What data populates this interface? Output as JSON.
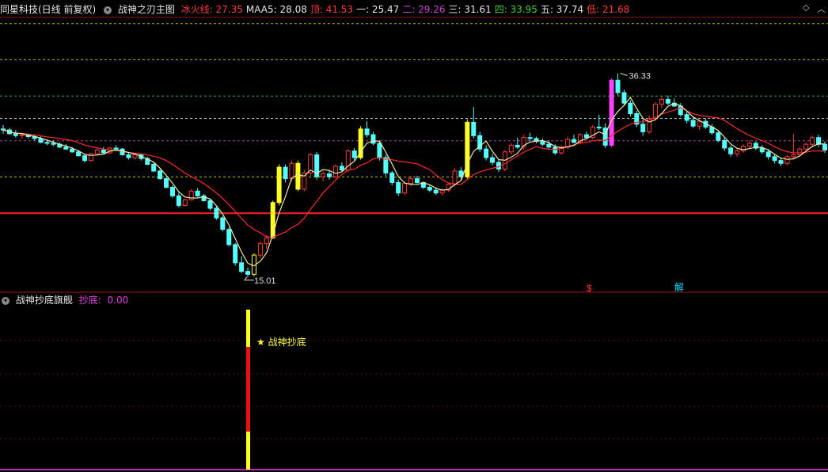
{
  "top_header": {
    "security": "同星科技(日线 前复权)",
    "indicator_name": "战神之刃主图",
    "items": [
      {
        "label": "冰火线: ",
        "value": "27.35",
        "color": "#ff3b3b"
      },
      {
        "label": "MAA5: ",
        "value": "28.08",
        "color": "#e8e8e8"
      },
      {
        "label": "顶: ",
        "value": "41.53",
        "color": "#ff3b3b"
      },
      {
        "label": "一: ",
        "value": "25.47",
        "color": "#e8e8e8"
      },
      {
        "label": "二: ",
        "value": "29.26",
        "color": "#d040d0"
      },
      {
        "label": "三: ",
        "value": "31.61",
        "color": "#e8e8e8"
      },
      {
        "label": "四: ",
        "value": "33.95",
        "color": "#3cd23c"
      },
      {
        "label": "五: ",
        "value": "37.74",
        "color": "#e8e8e8"
      },
      {
        "label": "低: ",
        "value": "21.68",
        "color": "#ff3b3b"
      }
    ]
  },
  "bottom_header": {
    "indicator_name": "战神抄底旗舰",
    "item_label": "抄底: ",
    "item_value": "0.00",
    "color": "#e040e0"
  },
  "corner_icons": [
    "diamond-icon",
    "chevron-up-icon"
  ],
  "chart_data": [
    {
      "type": "candlestick",
      "y_range": [
        14.0,
        42.5
      ],
      "price_levels": [
        {
          "name": "顶",
          "value": 41.53,
          "style": "dashed",
          "color": "#d8d800"
        },
        {
          "name": "五",
          "value": 37.74,
          "style": "dashed",
          "color": "#c8c800"
        },
        {
          "name": "四",
          "value": 33.95,
          "style": "dashed",
          "color": "#3cd23c"
        },
        {
          "name": "三",
          "value": 31.61,
          "style": "dashed",
          "color": "#e0e0e0"
        },
        {
          "name": "二",
          "value": 29.26,
          "style": "dashed",
          "color": "#d040d0"
        },
        {
          "name": "一",
          "value": 25.47,
          "style": "dashed",
          "color": "#e0e000"
        },
        {
          "name": "低",
          "value": 21.68,
          "style": "solid",
          "color": "#ff2020"
        }
      ],
      "annotations": [
        {
          "text": "36.33",
          "type": "high"
        },
        {
          "text": "15.01",
          "type": "low"
        },
        {
          "text": "$",
          "color": "#ff3030"
        },
        {
          "text": "解",
          "color": "#00d8ff"
        }
      ],
      "candles": [
        [
          30.5,
          30.9,
          30.0,
          30.4
        ],
        [
          30.4,
          30.6,
          29.9,
          30.0
        ],
        [
          30.0,
          30.4,
          29.6,
          29.8
        ],
        [
          29.8,
          30.1,
          29.5,
          29.9
        ],
        [
          29.9,
          30.0,
          29.5,
          29.7
        ],
        [
          29.7,
          29.9,
          29.3,
          29.5
        ],
        [
          29.5,
          29.7,
          29.0,
          29.1
        ],
        [
          29.1,
          29.4,
          28.8,
          29.0
        ],
        [
          29.0,
          29.3,
          28.7,
          28.9
        ],
        [
          28.9,
          29.1,
          28.5,
          28.6
        ],
        [
          28.6,
          28.9,
          28.3,
          28.4
        ],
        [
          28.4,
          28.6,
          28.0,
          28.1
        ],
        [
          28.1,
          28.3,
          27.6,
          27.7
        ],
        [
          27.7,
          27.9,
          27.0,
          27.2
        ],
        [
          27.2,
          28.0,
          27.1,
          27.9
        ],
        [
          27.9,
          28.5,
          27.8,
          28.3
        ],
        [
          28.3,
          28.6,
          27.9,
          28.0
        ],
        [
          28.0,
          28.6,
          27.9,
          28.5
        ],
        [
          28.5,
          28.8,
          28.2,
          28.4
        ],
        [
          28.4,
          28.5,
          27.7,
          27.8
        ],
        [
          27.8,
          28.0,
          27.3,
          27.5
        ],
        [
          27.5,
          27.9,
          27.3,
          27.8
        ],
        [
          27.8,
          27.9,
          27.2,
          27.4
        ],
        [
          27.4,
          27.6,
          26.7,
          26.8
        ],
        [
          26.8,
          27.0,
          26.0,
          26.1
        ],
        [
          26.1,
          26.3,
          25.2,
          25.3
        ],
        [
          25.3,
          25.5,
          24.3,
          24.4
        ],
        [
          24.4,
          24.6,
          23.3,
          23.5
        ],
        [
          23.5,
          23.8,
          22.3,
          22.5
        ],
        [
          22.5,
          23.2,
          22.4,
          23.1
        ],
        [
          23.1,
          24.2,
          23.0,
          24.0
        ],
        [
          24.0,
          24.3,
          23.4,
          23.5
        ],
        [
          23.5,
          23.7,
          22.9,
          23.0
        ],
        [
          23.0,
          23.2,
          22.0,
          22.2
        ],
        [
          22.2,
          22.4,
          21.0,
          21.2
        ],
        [
          21.2,
          21.4,
          19.8,
          20.0
        ],
        [
          20.0,
          20.2,
          18.2,
          18.4
        ],
        [
          18.4,
          18.6,
          16.2,
          16.5
        ],
        [
          16.5,
          17.2,
          15.4,
          15.6
        ],
        [
          15.6,
          16.0,
          15.01,
          15.3
        ],
        [
          15.3,
          17.5,
          15.1,
          17.3
        ],
        [
          17.3,
          18.8,
          17.0,
          18.5
        ],
        [
          18.5,
          19.4,
          18.0,
          19.1
        ],
        [
          19.1,
          23.0,
          19.0,
          22.8
        ],
        [
          22.8,
          26.8,
          22.5,
          26.5
        ],
        [
          26.5,
          26.8,
          24.9,
          25.3
        ],
        [
          25.3,
          27.2,
          25.0,
          26.9
        ],
        [
          26.9,
          27.2,
          24.0,
          24.2
        ],
        [
          24.2,
          26.2,
          24.0,
          25.9
        ],
        [
          25.9,
          28.0,
          25.6,
          27.8
        ],
        [
          27.8,
          28.1,
          25.2,
          25.5
        ],
        [
          25.5,
          26.1,
          25.0,
          25.8
        ],
        [
          25.8,
          26.2,
          25.2,
          25.5
        ],
        [
          25.5,
          26.8,
          25.3,
          26.6
        ],
        [
          26.6,
          27.0,
          26.0,
          26.2
        ],
        [
          26.2,
          28.4,
          26.0,
          28.2
        ],
        [
          28.2,
          28.5,
          27.2,
          27.5
        ],
        [
          27.5,
          30.8,
          27.3,
          30.5
        ],
        [
          30.5,
          31.3,
          29.6,
          29.9
        ],
        [
          29.9,
          30.2,
          28.8,
          29.0
        ],
        [
          29.0,
          29.3,
          27.2,
          27.5
        ],
        [
          27.5,
          27.8,
          25.6,
          25.9
        ],
        [
          25.9,
          26.1,
          24.6,
          24.9
        ],
        [
          24.9,
          25.2,
          23.5,
          23.8
        ],
        [
          23.8,
          25.0,
          23.6,
          24.8
        ],
        [
          24.8,
          25.6,
          24.5,
          25.3
        ],
        [
          25.3,
          25.6,
          24.8,
          24.9
        ],
        [
          24.9,
          25.0,
          24.2,
          24.4
        ],
        [
          24.4,
          24.6,
          23.9,
          24.1
        ],
        [
          24.1,
          24.4,
          23.6,
          23.8
        ],
        [
          23.8,
          24.3,
          23.5,
          24.1
        ],
        [
          24.1,
          24.9,
          23.9,
          24.7
        ],
        [
          24.7,
          26.4,
          24.5,
          26.1
        ],
        [
          26.1,
          26.5,
          25.2,
          25.5
        ],
        [
          25.5,
          31.5,
          25.3,
          31.2
        ],
        [
          31.2,
          32.8,
          29.5,
          29.8
        ],
        [
          29.8,
          30.2,
          28.1,
          28.4
        ],
        [
          28.4,
          28.8,
          27.2,
          27.5
        ],
        [
          27.5,
          27.9,
          26.7,
          27.0
        ],
        [
          27.0,
          27.3,
          26.0,
          26.3
        ],
        [
          26.3,
          28.3,
          26.1,
          28.1
        ],
        [
          28.1,
          29.0,
          27.8,
          28.8
        ],
        [
          28.8,
          29.6,
          28.4,
          28.6
        ],
        [
          28.6,
          29.9,
          28.3,
          29.6
        ],
        [
          29.6,
          30.1,
          29.2,
          29.5
        ],
        [
          29.5,
          29.7,
          29.0,
          29.2
        ],
        [
          29.2,
          29.5,
          28.7,
          28.9
        ],
        [
          28.9,
          29.3,
          28.4,
          28.6
        ],
        [
          28.6,
          28.9,
          27.8,
          28.0
        ],
        [
          28.0,
          28.8,
          27.8,
          28.6
        ],
        [
          28.6,
          29.7,
          28.4,
          29.4
        ],
        [
          29.4,
          29.9,
          29.0,
          29.1
        ],
        [
          29.1,
          30.1,
          28.9,
          29.9
        ],
        [
          29.9,
          30.2,
          29.4,
          29.6
        ],
        [
          29.6,
          30.9,
          29.4,
          30.7
        ],
        [
          30.7,
          32.0,
          30.4,
          30.6
        ],
        [
          30.6,
          31.1,
          28.5,
          28.8
        ],
        [
          28.8,
          35.8,
          28.6,
          35.6
        ],
        [
          35.6,
          36.33,
          34.0,
          34.3
        ],
        [
          34.3,
          34.6,
          33.0,
          33.2
        ],
        [
          33.2,
          33.5,
          31.8,
          32.1
        ],
        [
          32.1,
          32.4,
          30.7,
          31.0
        ],
        [
          31.0,
          31.5,
          29.8,
          30.2
        ],
        [
          30.2,
          31.9,
          30.0,
          31.6
        ],
        [
          31.6,
          33.3,
          31.4,
          33.1
        ],
        [
          33.1,
          33.9,
          32.7,
          33.6
        ],
        [
          33.6,
          34.0,
          33.0,
          33.2
        ],
        [
          33.2,
          33.7,
          32.8,
          32.9
        ],
        [
          32.9,
          33.2,
          31.8,
          32.0
        ],
        [
          32.0,
          32.3,
          31.1,
          31.4
        ],
        [
          31.4,
          31.7,
          30.6,
          30.8
        ],
        [
          30.8,
          31.5,
          30.4,
          31.3
        ],
        [
          31.3,
          31.6,
          30.5,
          30.7
        ],
        [
          30.7,
          31.0,
          29.9,
          30.1
        ],
        [
          30.1,
          30.3,
          29.1,
          29.3
        ],
        [
          29.3,
          29.6,
          28.2,
          28.5
        ],
        [
          28.5,
          28.8,
          27.6,
          27.9
        ],
        [
          27.9,
          28.4,
          27.6,
          28.2
        ],
        [
          28.2,
          28.9,
          28.0,
          28.7
        ],
        [
          28.7,
          29.3,
          28.5,
          29.0
        ],
        [
          29.0,
          29.2,
          28.3,
          28.5
        ],
        [
          28.5,
          28.8,
          27.9,
          28.1
        ],
        [
          28.1,
          28.4,
          27.3,
          27.6
        ],
        [
          27.6,
          27.9,
          26.9,
          27.2
        ],
        [
          27.2,
          27.5,
          26.6,
          26.9
        ],
        [
          26.9,
          27.8,
          26.7,
          27.6
        ],
        [
          27.6,
          30.0,
          27.4,
          27.8
        ],
        [
          27.8,
          28.6,
          27.6,
          28.4
        ],
        [
          28.4,
          29.1,
          28.2,
          28.9
        ],
        [
          28.9,
          29.8,
          28.7,
          29.6
        ],
        [
          29.6,
          29.9,
          28.6,
          28.9
        ],
        [
          28.9,
          29.2,
          28.0,
          28.3
        ]
      ],
      "ma_white": "MAA5",
      "ma_red": "冰火线"
    },
    {
      "type": "bar",
      "signal_label": "★ 战神抄底",
      "signal_bar_index": 39,
      "segments": [
        "yellow",
        "red",
        "yellow"
      ]
    }
  ]
}
